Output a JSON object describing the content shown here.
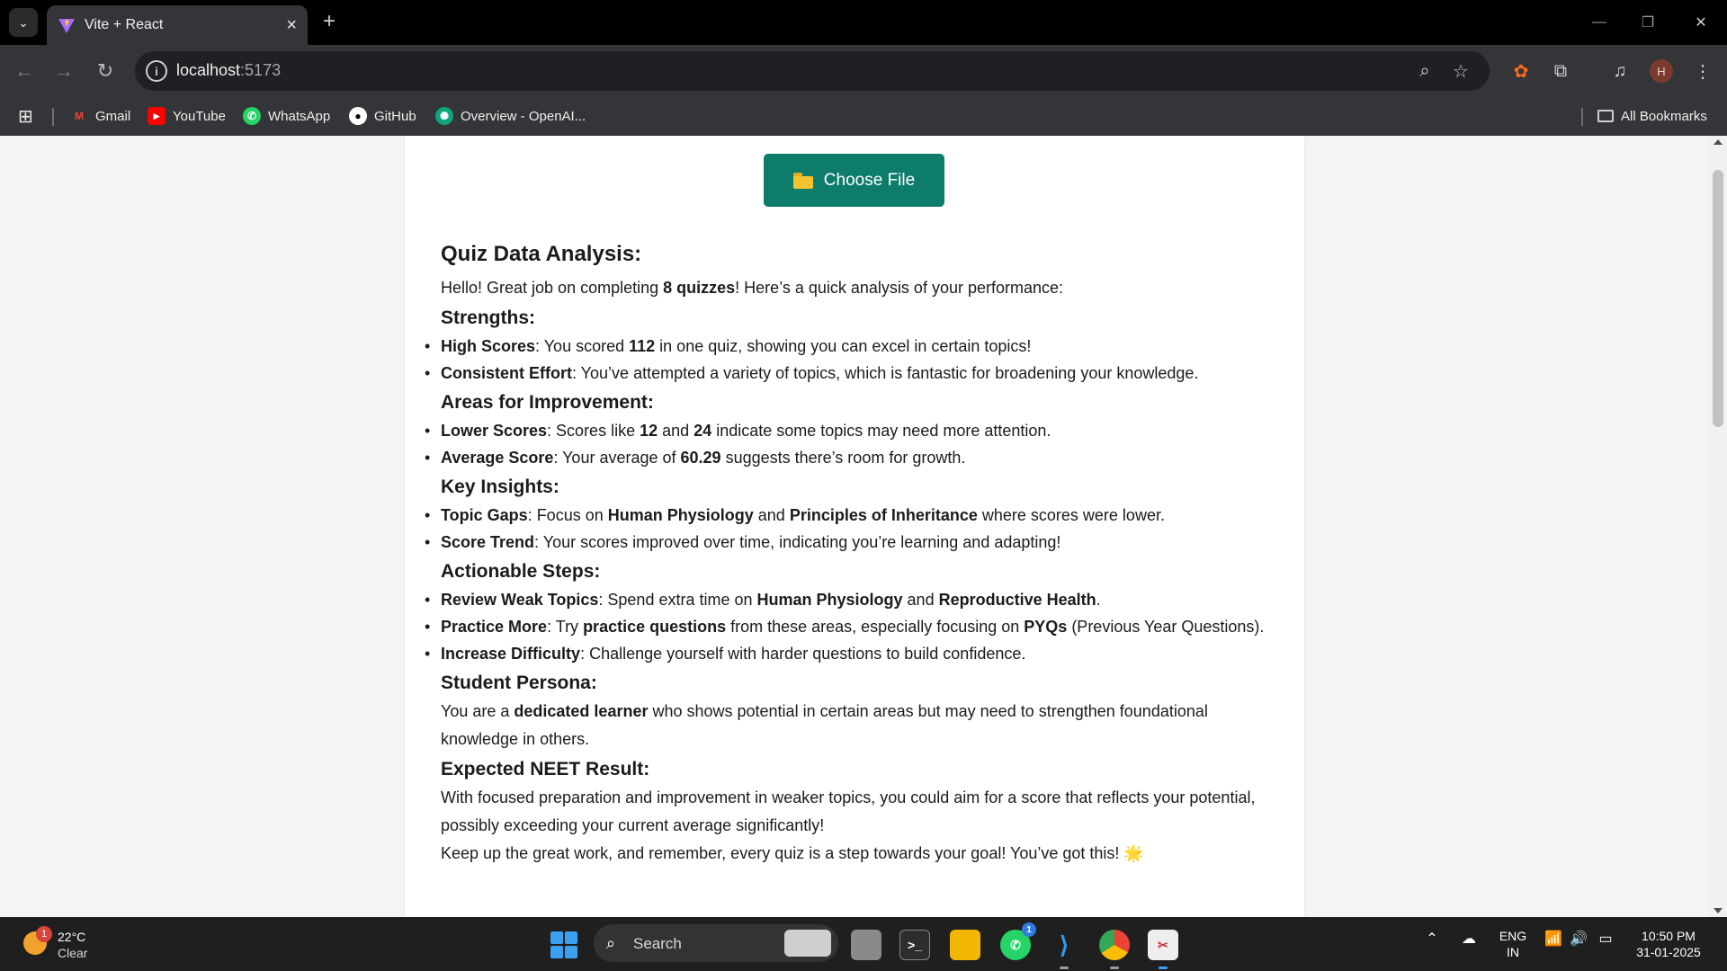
{
  "browser": {
    "tab_title": "Vite + React",
    "url_host": "localhost",
    "url_port": ":5173",
    "bookmarks": [
      "Gmail",
      "YouTube",
      "WhatsApp",
      "GitHub",
      "Overview - OpenAI..."
    ],
    "all_bookmarks": "All Bookmarks",
    "profile_initial": "H"
  },
  "page": {
    "choose_file": "Choose File",
    "analysis": {
      "title": "Quiz Data Analysis:",
      "intro_pre": "Hello! Great job on completing ",
      "intro_bold": "8 quizzes",
      "intro_post": "! Here’s a quick analysis of your performance:",
      "strengths_title": "Strengths:",
      "s1_b": "High Scores",
      "s1_a": ": You scored ",
      "s1_b2": "112",
      "s1_c": " in one quiz, showing you can excel in certain topics!",
      "s2_b": "Consistent Effort",
      "s2_a": ": You’ve attempted a variety of topics, which is fantastic for broadening your knowledge.",
      "improve_title": "Areas for Improvement:",
      "i1_b": "Lower Scores",
      "i1_a": ": Scores like ",
      "i1_b2": "12",
      "i1_c": " and ",
      "i1_b3": "24",
      "i1_d": " indicate some topics may need more attention.",
      "i2_b": "Average Score",
      "i2_a": ": Your average of ",
      "i2_b2": "60.29",
      "i2_c": " suggests there’s room for growth.",
      "insights_title": "Key Insights:",
      "k1_b": "Topic Gaps",
      "k1_a": ": Focus on ",
      "k1_b2": "Human Physiology",
      "k1_c": " and ",
      "k1_b3": "Principles of Inheritance",
      "k1_d": " where scores were lower.",
      "k2_b": "Score Trend",
      "k2_a": ": Your scores improved over time, indicating you’re learning and adapting!",
      "steps_title": "Actionable Steps:",
      "a1_b": "Review Weak Topics",
      "a1_a": ": Spend extra time on ",
      "a1_b2": "Human Physiology",
      "a1_c": " and ",
      "a1_b3": "Reproductive Health",
      "a1_d": ".",
      "a2_b": "Practice More",
      "a2_a": ": Try ",
      "a2_b2": "practice questions",
      "a2_c": " from these areas, especially focusing on ",
      "a2_b3": "PYQs",
      "a2_d": " (Previous Year Questions).",
      "a3_b": "Increase Difficulty",
      "a3_a": ": Challenge yourself with harder questions to build confidence.",
      "persona_title": "Student Persona:",
      "persona_pre": "You are a ",
      "persona_bold": "dedicated learner",
      "persona_post": " who shows potential in certain areas but may need to strengthen foundational knowledge in others.",
      "neet_title": "Expected NEET Result:",
      "neet_text": "With focused preparation and improvement in weaker topics, you could aim for a score that reflects your potential, possibly exceeding your current average significantly!",
      "closing": "Keep up the great work, and remember, every quiz is a step towards your goal! You’ve got this! 🌟"
    }
  },
  "taskbar": {
    "weather_temp": "22°C",
    "weather_cond": "Clear",
    "weather_badge": "1",
    "search_label": "Search",
    "whatsapp_badge": "1",
    "lang_top": "ENG",
    "lang_bottom": "IN",
    "time": "10:50 PM",
    "date": "31-01-2025"
  },
  "colors": {
    "accent_button": "#0e7c6b",
    "tab_bg": "#333538",
    "taskbar_bg": "#1f1f1f"
  }
}
